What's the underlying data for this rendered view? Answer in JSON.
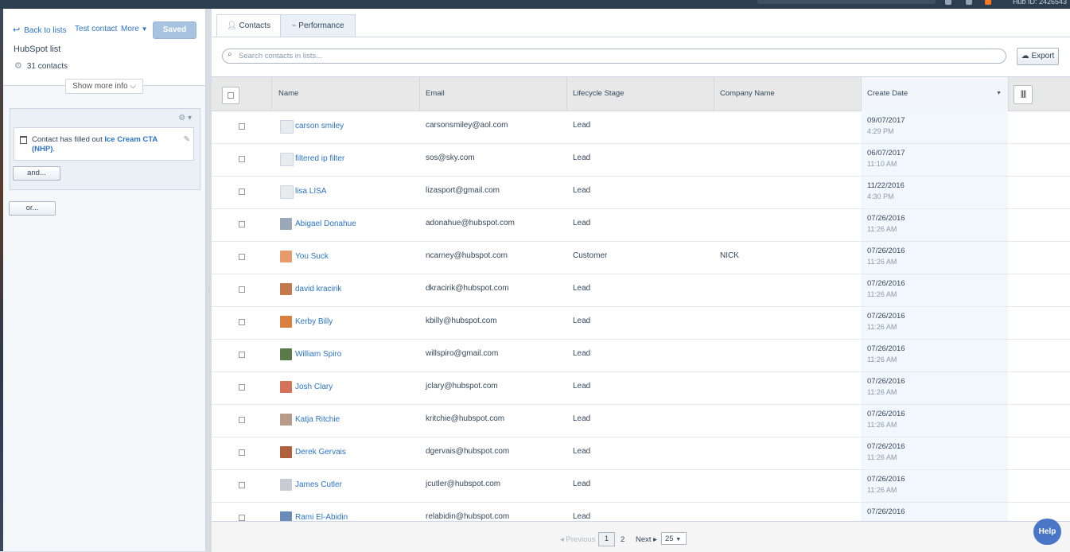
{
  "topbar": {
    "hub_id": "Hub ID: 2426543"
  },
  "sidebar": {
    "back_label": "Back to lists",
    "test_label": "Test contact",
    "more_label": "More",
    "saved_label": "Saved",
    "list_title": "HubSpot list",
    "contact_count": "31 contacts",
    "show_more_label": "Show more info",
    "filter": {
      "prefix": "Contact has filled out ",
      "form_name": "Ice Cream CTA (NHP)",
      "suffix": "."
    },
    "and_label": "and...",
    "or_label": "or..."
  },
  "tabs": [
    {
      "label": "Contacts",
      "icon": "person-icon",
      "active": true
    },
    {
      "label": "Performance",
      "icon": "pulse-icon",
      "active": false
    }
  ],
  "search": {
    "placeholder": "Search contacts in lists..."
  },
  "export_label": "Export",
  "table": {
    "columns": [
      "Name",
      "Email",
      "Lifecycle Stage",
      "Company Name",
      "Create Date"
    ],
    "sorted_column": "Create Date",
    "rows": [
      {
        "name": "carson smiley",
        "email": "carsonsmiley@aol.com",
        "stage": "Lead",
        "company": "",
        "date": "09/07/2017",
        "time": "4:29 PM",
        "avatar_color": "#e8ebee"
      },
      {
        "name": "filtered ip filter",
        "email": "sos@sky.com",
        "stage": "Lead",
        "company": "",
        "date": "06/07/2017",
        "time": "11:10 AM",
        "avatar_color": "#e8ebee"
      },
      {
        "name": "lisa LISA",
        "email": "lizasport@gmail.com",
        "stage": "Lead",
        "company": "",
        "date": "11/22/2016",
        "time": "4:30 PM",
        "avatar_color": "#e8ebee"
      },
      {
        "name": "Abigael Donahue",
        "email": "adonahue@hubspot.com",
        "stage": "Lead",
        "company": "",
        "date": "07/26/2016",
        "time": "11:26 AM",
        "avatar_color": "#9aa8b8"
      },
      {
        "name": "You Suck",
        "email": "ncarney@hubspot.com",
        "stage": "Customer",
        "company": "NICK",
        "date": "07/26/2016",
        "time": "11:26 AM",
        "avatar_color": "#e89a6a"
      },
      {
        "name": "david kracirik",
        "email": "dkracirik@hubspot.com",
        "stage": "Lead",
        "company": "",
        "date": "07/26/2016",
        "time": "11:26 AM",
        "avatar_color": "#c27a4a"
      },
      {
        "name": "Kerby Billy",
        "email": "kbilly@hubspot.com",
        "stage": "Lead",
        "company": "",
        "date": "07/26/2016",
        "time": "11:26 AM",
        "avatar_color": "#d9803c"
      },
      {
        "name": "William Spiro",
        "email": "willspiro@gmail.com",
        "stage": "Lead",
        "company": "",
        "date": "07/26/2016",
        "time": "11:26 AM",
        "avatar_color": "#5a7a4a"
      },
      {
        "name": "Josh Clary",
        "email": "jclary@hubspot.com",
        "stage": "Lead",
        "company": "",
        "date": "07/26/2016",
        "time": "11:26 AM",
        "avatar_color": "#d4735a"
      },
      {
        "name": "Katja Ritchie",
        "email": "kritchie@hubspot.com",
        "stage": "Lead",
        "company": "",
        "date": "07/26/2016",
        "time": "11:26 AM",
        "avatar_color": "#b89a8a"
      },
      {
        "name": "Derek Gervais",
        "email": "dgervais@hubspot.com",
        "stage": "Lead",
        "company": "",
        "date": "07/26/2016",
        "time": "11:26 AM",
        "avatar_color": "#b0603a"
      },
      {
        "name": "James Cutler",
        "email": "jcutler@hubspot.com",
        "stage": "Lead",
        "company": "",
        "date": "07/26/2016",
        "time": "11:26 AM",
        "avatar_color": "#c8ccd2"
      },
      {
        "name": "Rami El-Abidin",
        "email": "relabidin@hubspot.com",
        "stage": "Lead",
        "company": "",
        "date": "07/26/2016",
        "time": "",
        "avatar_color": "#6a8ab8"
      }
    ]
  },
  "pagination": {
    "previous_label": "Previous",
    "current_page": "1",
    "page_two": "2",
    "next_label": "Next",
    "page_size": "25"
  },
  "help_label": "Help",
  "colors": {
    "accent": "#2a74c8",
    "sorted_column": "#f2f7fd",
    "saved_button": "#a7c3e0"
  }
}
